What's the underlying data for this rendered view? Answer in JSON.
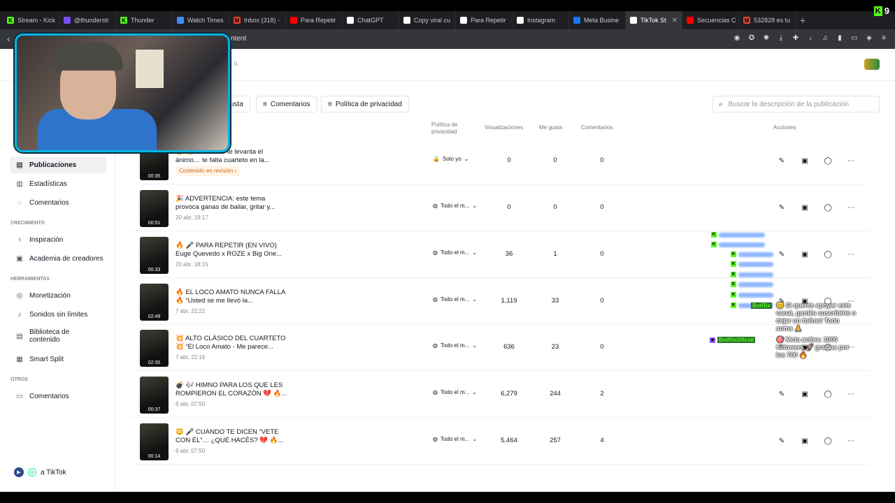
{
  "browser": {
    "tabs": [
      {
        "label": "Stream - Kick",
        "color": "#53fc18",
        "fav": "K"
      },
      {
        "label": "@thunderstr",
        "color": "#7b4cff",
        "fav": ""
      },
      {
        "label": "Thunder",
        "color": "#53fc18",
        "fav": "K"
      },
      {
        "label": "Watch Times",
        "color": "#3d8bfd",
        "fav": ""
      },
      {
        "label": "Inbox (318) -",
        "color": "#ea4335",
        "fav": "M"
      },
      {
        "label": "Para Repetir",
        "color": "#ff0000",
        "fav": ""
      },
      {
        "label": "ChatGPT",
        "color": "#ffffff",
        "fav": ""
      },
      {
        "label": "Copy viral cu",
        "color": "#ffffff",
        "fav": ""
      },
      {
        "label": "Para Repetir",
        "color": "#ffffff",
        "fav": ""
      },
      {
        "label": "Instagram",
        "color": "#ffffff",
        "fav": ""
      },
      {
        "label": "Meta Busine",
        "color": "#1877f2",
        "fav": ""
      },
      {
        "label": "TikTok St",
        "color": "#ffffff",
        "fav": "",
        "active": true
      },
      {
        "label": "Secuencias C",
        "color": "#ff0000",
        "fav": ""
      },
      {
        "label": "532828 es tu",
        "color": "#ea4335",
        "fav": "M"
      }
    ],
    "new_tab": "+",
    "url_fragment": "ntent",
    "kick_count": "9"
  },
  "page": {
    "stats_fragment": "es: 0",
    "filters": [
      {
        "label": "e gusta",
        "icon": "filter-icon"
      },
      {
        "label": "Comentarios",
        "icon": "filter-icon"
      },
      {
        "label": "Política de privacidad",
        "icon": "filter-icon"
      }
    ],
    "search_placeholder": "Buscar la descripción de la publicación"
  },
  "sidebar": {
    "items": [
      {
        "label": "Publicaciones",
        "icon": "list-icon",
        "active": true
      },
      {
        "label": "Estadísticas",
        "icon": "chart-icon"
      },
      {
        "label": "Comentarios",
        "icon": "comment-icon"
      }
    ],
    "section_growth": "CRECIMIENTO",
    "growth_items": [
      {
        "label": "Inspiración",
        "icon": "bulb-icon"
      },
      {
        "label": "Academia de creadores",
        "icon": "academy-icon"
      }
    ],
    "section_tools": "HERRAMIENTAS",
    "tool_items": [
      {
        "label": "Monetización",
        "icon": "money-icon"
      },
      {
        "label": "Sonidos sin límites",
        "icon": "music-icon"
      },
      {
        "label": "Biblioteca de contenido",
        "icon": "library-icon"
      },
      {
        "label": "Smart Split",
        "icon": "split-icon"
      }
    ],
    "section_other": "OTROS",
    "other_items": [
      {
        "label": "Comentarios",
        "icon": "comment-icon"
      }
    ],
    "footer": "a TikTok"
  },
  "table": {
    "headers": {
      "privacy": "Política de privacidad",
      "views": "Visualizaciones",
      "likes": "Me gusta",
      "comments": "Comentarios",
      "actions": "Acciones"
    },
    "rows": [
      {
        "title": "😮 🔥 Si esto no te levanta el ánimo… te falta cuarteto en la...",
        "date": "",
        "review": "Contenido en revisión ›",
        "duration": "00:35",
        "privacy": "Solo yo",
        "views": "0",
        "likes": "0",
        "comments": "0"
      },
      {
        "title": "🎉 ADVERTENCIA: este tema provoca ganas de bailar, gritar y...",
        "date": "20 abr, 18:17",
        "duration": "00:51",
        "privacy": "Todo el m...",
        "views": "0",
        "likes": "0",
        "comments": "0"
      },
      {
        "title": "🔥 🎤 PARA REPETIR (EN VIVO) Euge Quevedo x ROZE x Big One...",
        "date": "20 abr, 18:15",
        "duration": "00:33",
        "privacy": "Todo el m...",
        "views": "36",
        "likes": "1",
        "comments": "0"
      },
      {
        "title": "🔥 EL LOCO AMATO NUNCA FALLA 🔥 “Usted se me llevó la...",
        "date": "7 abr, 22:22",
        "duration": "02:49",
        "privacy": "Todo el m...",
        "views": "1,119",
        "likes": "33",
        "comments": "0"
      },
      {
        "title": "💥 ALTO CLÁSICO DEL CUARTETO 💥 “El Loco Amato - Me parece...",
        "date": "7 abr, 22:16",
        "duration": "02:35",
        "privacy": "Todo el m...",
        "views": "636",
        "likes": "23",
        "comments": "0"
      },
      {
        "title": "💣 🎶 HIMNO PARA LOS QUE LES ROMPIERON EL CORAZÓN 💔 🔥...",
        "date": "6 abr, 07:50",
        "duration": "00:37",
        "privacy": "Todo el m...",
        "views": "6,279",
        "likes": "244",
        "comments": "2"
      },
      {
        "title": "😳 🎤 CUANDO TE DICEN “VETE CON ÉL”… ¿QUÉ HACÉS? 💔 🔥...",
        "date": "6 abr, 07:50",
        "duration": "00:14",
        "privacy": "Todo el m...",
        "views": "5,464",
        "likes": "257",
        "comments": "4"
      }
    ]
  },
  "stream_overlay": {
    "bot_name": "BotRixOficial",
    "bot_name_short": "BotRix",
    "message_1": "😊 Si querés apoyar este canal, ¡podés suscribirte o dejar un follow! Todo suma 🙏",
    "message_2": "🎯 Meta activa: 1000 followers 🚀 gracias por los 700 🔥"
  },
  "colors": {
    "kick_green": "#53fc18",
    "webcam_border": "#00b5e2",
    "review_orange": "#d2691e"
  }
}
